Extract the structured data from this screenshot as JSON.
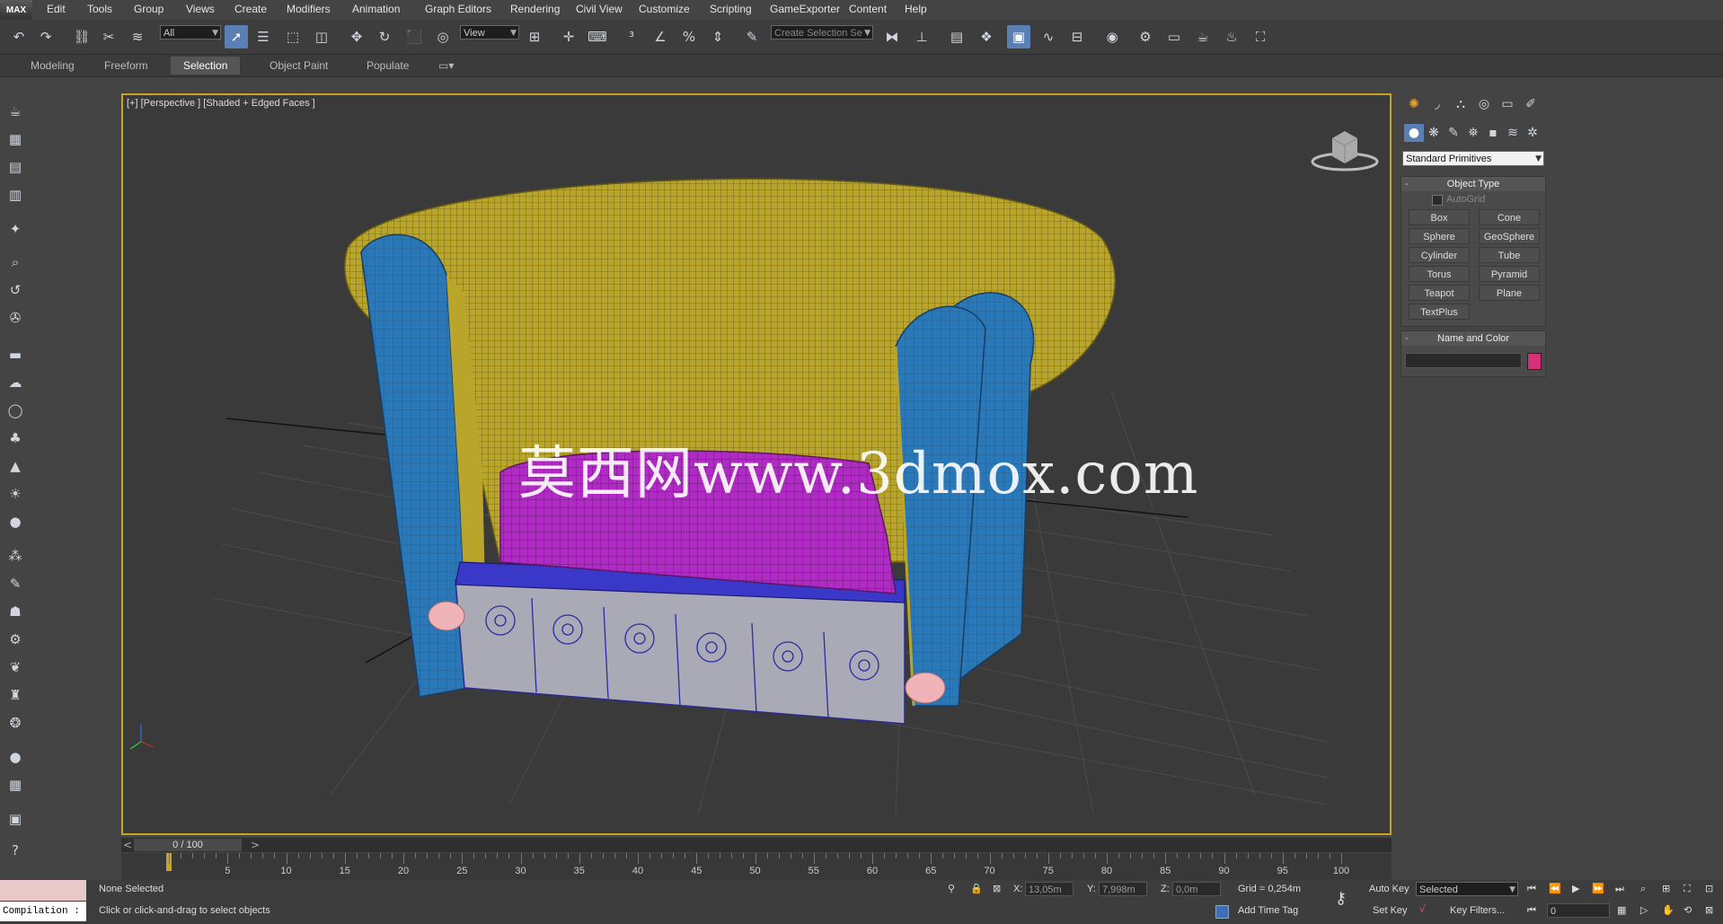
{
  "app": {
    "logo": "MAX"
  },
  "menu": [
    "Edit",
    "Tools",
    "Group",
    "Views",
    "Create",
    "Modifiers",
    "Animation",
    "Graph Editors",
    "Rendering",
    "Civil View",
    "Customize",
    "Scripting",
    "GameExporter",
    "Content",
    "Help"
  ],
  "toolbar": {
    "selection_filter": "All",
    "ref_coord": "View",
    "named_selection_placeholder": "Create Selection Se",
    "icons": [
      "undo-icon",
      "redo-icon",
      "link-icon",
      "unlink-icon",
      "bind-spacewarp-icon",
      "select-object-icon",
      "select-by-name-icon",
      "rect-region-icon",
      "window-crossing-icon",
      "move-icon",
      "rotate-icon",
      "scale-icon",
      "place-icon",
      "pivot-icon",
      "manipulate-icon",
      "keyboard-shortcut-icon",
      "snap-3d-icon",
      "angle-snap-icon",
      "percent-snap-icon",
      "spinner-snap-icon",
      "edit-named-sets-icon",
      "mirror-icon",
      "align-icon",
      "layer-icon",
      "scene-explorer-icon",
      "graphite-icon",
      "curve-editor-icon",
      "schematic-icon",
      "material-editor-icon",
      "render-setup-icon",
      "render-frame-icon",
      "render-icon",
      "render-iterative-icon",
      "activeshade-icon"
    ]
  },
  "ribbon": {
    "tabs": [
      "Modeling",
      "Freeform",
      "Selection",
      "Object Paint",
      "Populate"
    ],
    "active": "Selection"
  },
  "left_tools": [
    "teapot-icon",
    "render-setup-icon",
    "film-icon",
    "table-icon",
    "light-icon",
    "camera-icon",
    "spin-icon",
    "film-reel-icon",
    "folder-icon",
    "cloud-icon",
    "sphere-icon",
    "grass-icon",
    "cone-icon",
    "sun-icon",
    "bulb-icon",
    "particles-icon",
    "paint-icon",
    "figure-icon",
    "gear-icon",
    "plant-icon",
    "hf-icon",
    "tree-icon",
    "ball-icon",
    "grid-icon",
    "object-icon",
    "help-icon"
  ],
  "viewport": {
    "label": "[+] [Perspective ] [Shaded + Edged Faces ]"
  },
  "watermark": "莫西网www.3dmox.com",
  "command_panel": {
    "main_tabs": [
      "create-tab-icon",
      "modify-tab-icon",
      "hierarchy-tab-icon",
      "motion-tab-icon",
      "display-tab-icon",
      "utilities-tab-icon"
    ],
    "sub_tabs": [
      "geometry-icon",
      "shapes-icon",
      "lights-icon",
      "cameras-icon",
      "helpers-icon",
      "spacewarps-icon",
      "systems-icon"
    ],
    "category": "Standard Primitives",
    "object_type": {
      "title": "Object Type",
      "autogrid": "AutoGrid",
      "buttons": [
        "Box",
        "Cone",
        "Sphere",
        "GeoSphere",
        "Cylinder",
        "Tube",
        "Torus",
        "Pyramid",
        "Teapot",
        "Plane",
        "TextPlus"
      ]
    },
    "name_and_color": {
      "title": "Name and Color",
      "name_value": "",
      "color": "#d4317a"
    }
  },
  "timeline": {
    "slider": "0 / 100",
    "ticks": [
      "0",
      "5",
      "10",
      "15",
      "20",
      "25",
      "30",
      "35",
      "40",
      "45",
      "50",
      "55",
      "60",
      "65",
      "70",
      "75",
      "80",
      "85",
      "90",
      "95",
      "100"
    ]
  },
  "status": {
    "maxscript": "Compilation :",
    "selection": "None Selected",
    "prompt": "Click or click-and-drag to select objects",
    "x_label": "X:",
    "x": "13,05m",
    "y_label": "Y:",
    "y": "7,998m",
    "z_label": "Z:",
    "z": "0,0m",
    "grid": "Grid = 0,254m",
    "add_time_tag": "Add Time Tag",
    "auto_key": "Auto Key",
    "set_key": "Set Key",
    "key_mode": "Selected",
    "key_filters": "Key Filters...",
    "frame": "0"
  }
}
